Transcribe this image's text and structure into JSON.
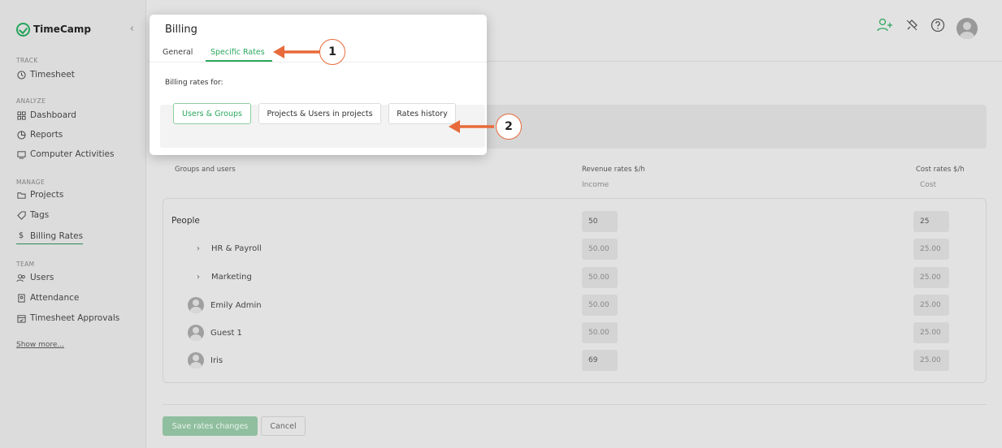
{
  "app": {
    "logo_text": "TimeCamp",
    "brand_color": "#2ba85d",
    "annotation_color": "#e86a3a"
  },
  "sidebar": {
    "sections": [
      {
        "label": "TRACK"
      },
      {
        "label": "ANALYZE"
      },
      {
        "label": "MANAGE"
      },
      {
        "label": "TEAM"
      }
    ],
    "items": [
      {
        "label": "Timesheet",
        "icon": "clock-icon"
      },
      {
        "label": "Dashboard",
        "icon": "grid-icon"
      },
      {
        "label": "Reports",
        "icon": "chart-icon"
      },
      {
        "label": "Computer Activities",
        "icon": "monitor-icon"
      },
      {
        "label": "Projects",
        "icon": "folder-icon"
      },
      {
        "label": "Tags",
        "icon": "tag-icon"
      },
      {
        "label": "Billing Rates",
        "icon": "dollar-icon",
        "active": true
      },
      {
        "label": "Users",
        "icon": "users-icon"
      },
      {
        "label": "Attendance",
        "icon": "attendance-icon"
      },
      {
        "label": "Timesheet Approvals",
        "icon": "calendar-check-icon"
      }
    ],
    "show_more": "Show more..."
  },
  "topbar": {
    "icons": [
      "add-user-icon",
      "plug-icon",
      "help-icon",
      "avatar"
    ]
  },
  "table": {
    "col_groups": "Groups and users",
    "col_revenue": "Revenue rates $/h",
    "col_revenue_sub": "Income",
    "col_cost": "Cost rates $/h",
    "col_cost_sub": "Cost",
    "rows": [
      {
        "label": "People",
        "revenue": "50",
        "cost": "25"
      },
      {
        "label": "HR & Payroll",
        "revenue": "50.00",
        "cost": "25.00"
      },
      {
        "label": "Marketing",
        "revenue": "50.00",
        "cost": "25.00"
      },
      {
        "label": "Emily Admin",
        "revenue": "50.00",
        "cost": "25.00"
      },
      {
        "label": "Guest 1",
        "revenue": "50.00",
        "cost": "25.00"
      },
      {
        "label": "Iris",
        "revenue": "69",
        "cost": "25.00"
      }
    ]
  },
  "footer": {
    "save_label": "Save rates changes",
    "cancel_label": "Cancel"
  },
  "modal": {
    "title": "Billing",
    "tabs": [
      {
        "label": "General"
      },
      {
        "label": "Specific Rates",
        "active": true
      }
    ],
    "rates_for": "Billing rates for:",
    "buttons": [
      {
        "label": "Users & Groups",
        "selected": true
      },
      {
        "label": "Projects & Users in projects"
      },
      {
        "label": "Rates history"
      }
    ]
  },
  "annotations": [
    {
      "number": "1"
    },
    {
      "number": "2"
    }
  ]
}
